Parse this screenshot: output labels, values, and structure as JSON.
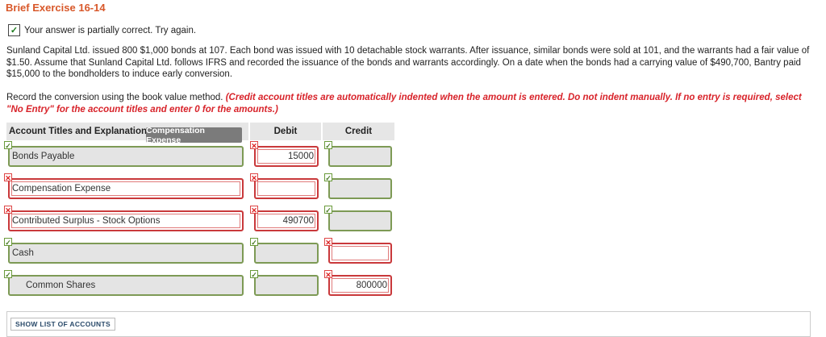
{
  "title": "Brief Exercise 16-14",
  "status": {
    "text": "Your answer is partially correct.  Try again."
  },
  "problem": "Sunland Capital Ltd. issued 800 $1,000 bonds at 107. Each bond was issued with 10 detachable stock warrants. After issuance, similar bonds were sold at 101, and the warrants had a fair value of $1.50. Assume that Sunland Capital Ltd. follows IFRS and recorded the issuance of the bonds and warrants accordingly. On a date when the bonds had a carrying value of $490,700, Bantry paid $15,000 to the bondholders to induce early conversion.",
  "instructions": {
    "plain": "Record the conversion using the book value method. ",
    "emphasis": "(Credit account titles are automatically indented when the amount is entered. Do not indent manually. If no entry is required, select \"No Entry\" for the account titles and enter 0 for the amounts.)"
  },
  "table": {
    "headers": {
      "account": "Account Titles and Explanation",
      "debit": "Debit",
      "credit": "Credit"
    },
    "tooltip": "Compensation Expense",
    "rows": [
      {
        "account": "Bonds Payable",
        "debit": "15000",
        "credit": "",
        "acct_status": "ok",
        "debit_status": "bad",
        "credit_status": "ok"
      },
      {
        "account": "Compensation Expense",
        "debit": "",
        "credit": "",
        "acct_status": "bad",
        "debit_status": "bad",
        "credit_status": "ok"
      },
      {
        "account": "Contributed Surplus - Stock Options",
        "debit": "490700",
        "credit": "",
        "acct_status": "bad",
        "debit_status": "bad",
        "credit_status": "ok"
      },
      {
        "account": "Cash",
        "debit": "",
        "credit": "",
        "acct_status": "ok",
        "debit_status": "ok",
        "credit_status": "bad"
      },
      {
        "account": "Common Shares",
        "debit": "",
        "credit": "800000",
        "acct_status": "ok",
        "debit_status": "ok",
        "credit_status": "bad"
      }
    ]
  },
  "show_accounts_label": "SHOW LIST OF ACCOUNTS"
}
